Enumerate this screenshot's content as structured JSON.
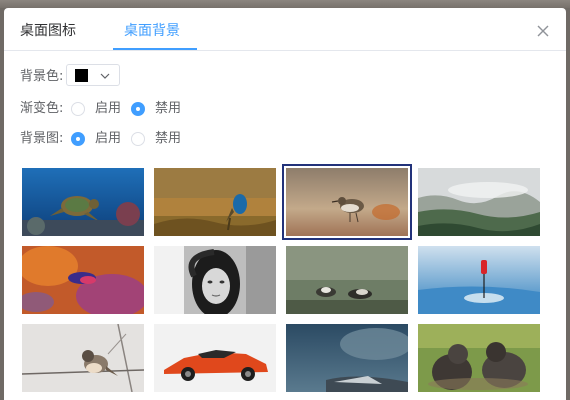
{
  "tabs": [
    {
      "label": "桌面图标",
      "active": false
    },
    {
      "label": "桌面背景",
      "active": true
    }
  ],
  "settings": {
    "bg_color": {
      "label": "背景色:",
      "value": "#000000"
    },
    "gradient": {
      "label": "渐变色:",
      "options": [
        "启用",
        "禁用"
      ],
      "selected": "禁用"
    },
    "bg_image": {
      "label": "背景图:",
      "options": [
        "启用",
        "禁用"
      ],
      "selected": "启用"
    }
  },
  "wallpapers": [
    {
      "subject": "sea turtle underwater"
    },
    {
      "subject": "bird on grass"
    },
    {
      "subject": "sandpiper",
      "selected": true
    },
    {
      "subject": "misty forest"
    },
    {
      "subject": "abstract colorful"
    },
    {
      "subject": "portrait woman black and white"
    },
    {
      "subject": "birds on rocks"
    },
    {
      "subject": "red marker on ice"
    },
    {
      "subject": "shrike on branch"
    },
    {
      "subject": "orange sports car"
    },
    {
      "subject": "stormy clouds over landscape"
    },
    {
      "subject": "sea lions"
    }
  ],
  "colors": {
    "accent": "#409eff",
    "selection_border": "#22327a"
  }
}
